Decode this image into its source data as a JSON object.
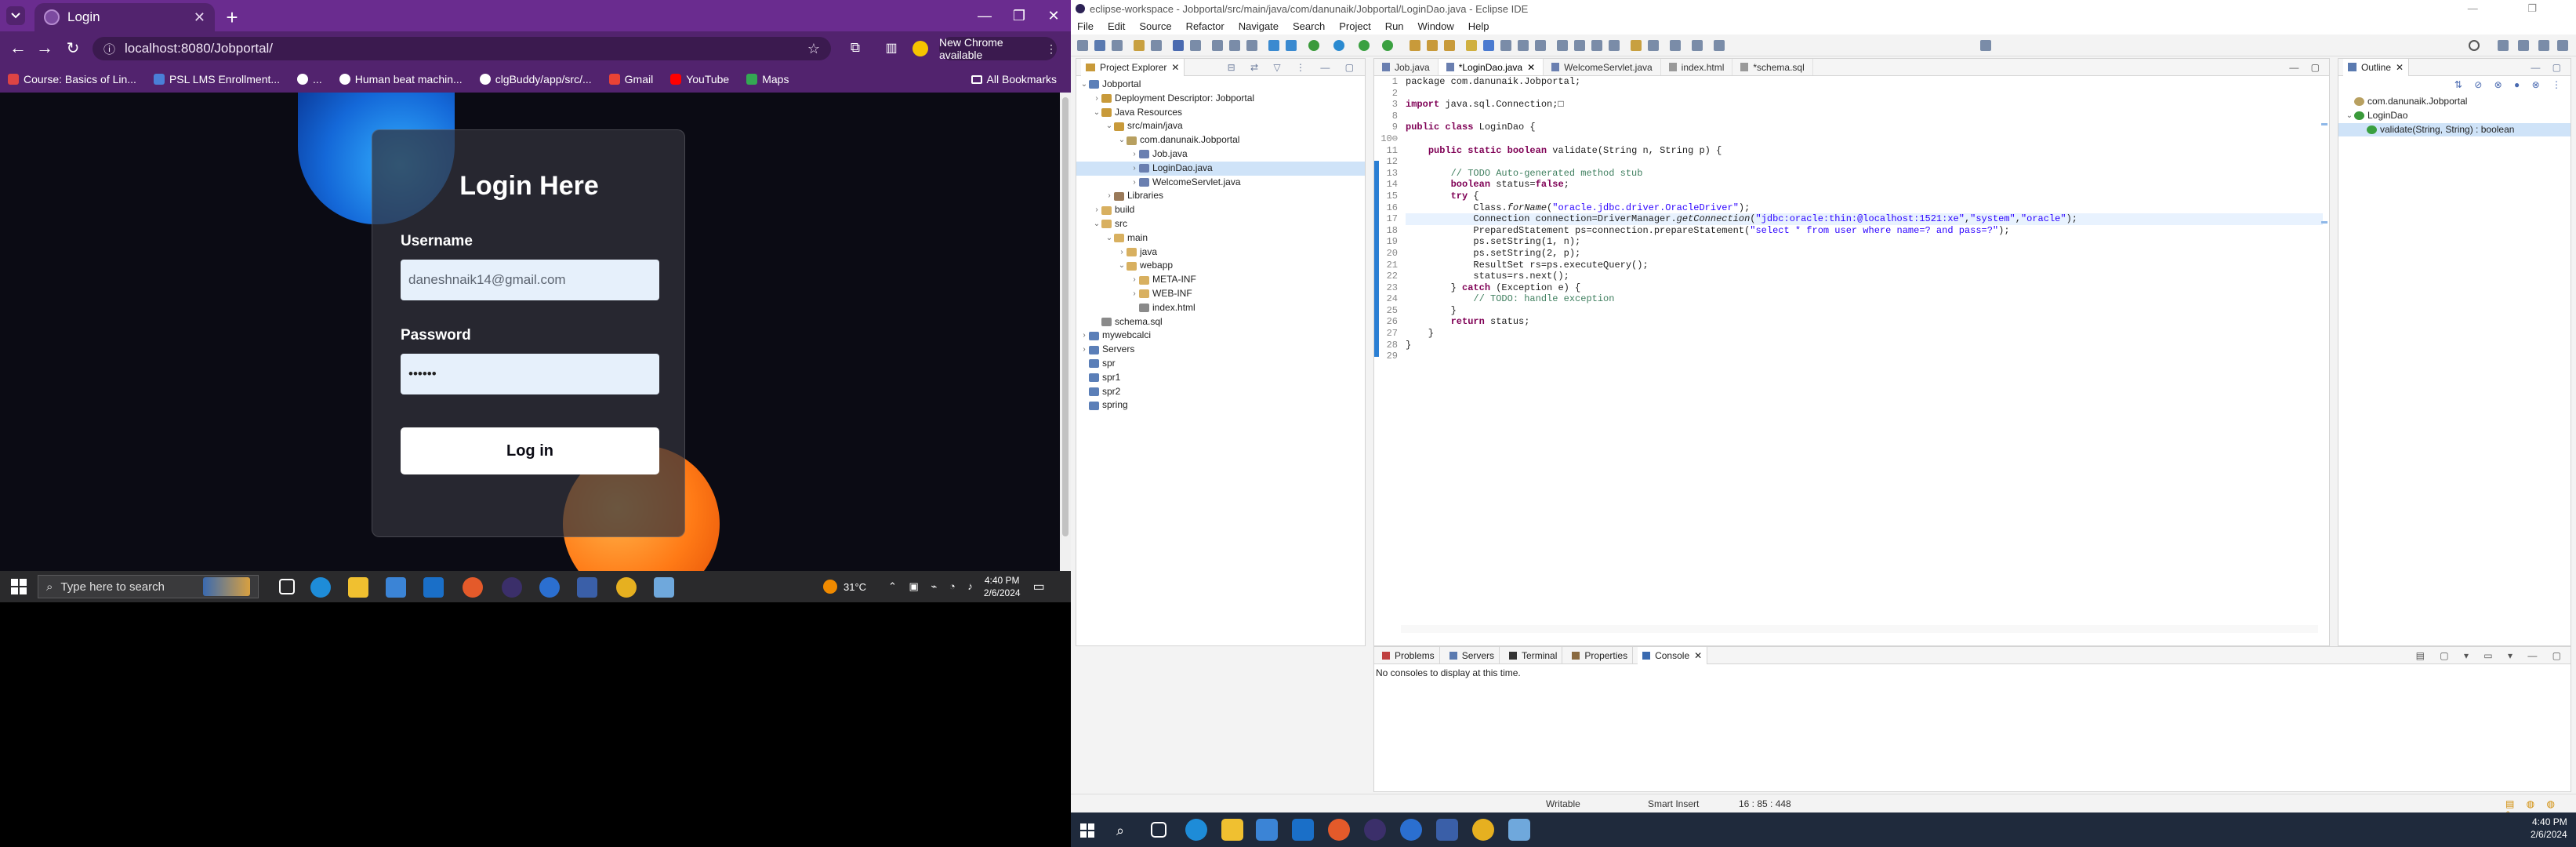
{
  "colors": {
    "chrome_frame": "#6a2c8f",
    "chrome_toolbar": "#52236e",
    "eclipse_bg": "#f3f3f3",
    "keyword": "#7f0055",
    "string": "#2a00ff",
    "comment": "#3f7f5f"
  },
  "chrome": {
    "tab_title": "Login",
    "url": "localhost:8080/Jobportal/",
    "update_label": "New Chrome available",
    "bookmarks": [
      "Course: Basics of Lin...",
      "PSL LMS Enrollment...",
      "...",
      "Human beat machin...",
      "clgBuddy/app/src/...",
      "Gmail",
      "YouTube",
      "Maps"
    ],
    "all_bookmarks": "All Bookmarks",
    "page": {
      "heading": "Login Here",
      "username_label": "Username",
      "username_value": "daneshnaik14@gmail.com",
      "password_label": "Password",
      "password_value": "••••••",
      "login_button": "Log in"
    }
  },
  "taskbar_left": {
    "search_placeholder": "Type here to search",
    "weather": "31°C",
    "time": "4:40 PM",
    "date": "2/6/2024"
  },
  "eclipse": {
    "title": "eclipse-workspace - Jobportal/src/main/java/com/danunaik/Jobportal/LoginDao.java - Eclipse IDE",
    "menu": [
      "File",
      "Edit",
      "Source",
      "Refactor",
      "Navigate",
      "Search",
      "Project",
      "Run",
      "Window",
      "Help"
    ],
    "explorer_tab": "Project Explorer",
    "tree": [
      {
        "depth": 0,
        "arrow": "⌄",
        "label": "Jobportal",
        "color": "#5b7fb8"
      },
      {
        "depth": 1,
        "arrow": "›",
        "label": "Deployment Descriptor: Jobportal",
        "color": "#c89a3a"
      },
      {
        "depth": 1,
        "arrow": "⌄",
        "label": "Java Resources",
        "color": "#c89a3a"
      },
      {
        "depth": 2,
        "arrow": "⌄",
        "label": "src/main/java",
        "color": "#c89a3a"
      },
      {
        "depth": 3,
        "arrow": "⌄",
        "label": "com.danunaik.Jobportal",
        "color": "#b8a060"
      },
      {
        "depth": 4,
        "arrow": "›",
        "label": "Job.java",
        "color": "#6a7fb0"
      },
      {
        "depth": 4,
        "arrow": "›",
        "label": "LoginDao.java",
        "color": "#6a7fb0",
        "selected": true
      },
      {
        "depth": 4,
        "arrow": "›",
        "label": "WelcomeServlet.java",
        "color": "#6a7fb0"
      },
      {
        "depth": 2,
        "arrow": "›",
        "label": "Libraries",
        "color": "#9a7a5a"
      },
      {
        "depth": 1,
        "arrow": "›",
        "label": "build",
        "color": "#d8b060"
      },
      {
        "depth": 1,
        "arrow": "⌄",
        "label": "src",
        "color": "#d8b060"
      },
      {
        "depth": 2,
        "arrow": "⌄",
        "label": "main",
        "color": "#d8b060"
      },
      {
        "depth": 3,
        "arrow": "›",
        "label": "java",
        "color": "#d8b060"
      },
      {
        "depth": 3,
        "arrow": "⌄",
        "label": "webapp",
        "color": "#d8b060"
      },
      {
        "depth": 4,
        "arrow": "›",
        "label": "META-INF",
        "color": "#d8b060"
      },
      {
        "depth": 4,
        "arrow": "›",
        "label": "WEB-INF",
        "color": "#d8b060"
      },
      {
        "depth": 4,
        "arrow": "",
        "label": "index.html",
        "color": "#8a8a8a"
      },
      {
        "depth": 1,
        "arrow": "",
        "label": "schema.sql",
        "color": "#8a8a8a"
      },
      {
        "depth": 0,
        "arrow": "›",
        "label": "mywebcalci",
        "color": "#5b7fb8"
      },
      {
        "depth": 0,
        "arrow": "›",
        "label": "Servers",
        "color": "#5b7fb8"
      },
      {
        "depth": 0,
        "arrow": "",
        "label": "spr",
        "color": "#5b7fb8"
      },
      {
        "depth": 0,
        "arrow": "",
        "label": "spr1",
        "color": "#5b7fb8"
      },
      {
        "depth": 0,
        "arrow": "",
        "label": "spr2",
        "color": "#5b7fb8"
      },
      {
        "depth": 0,
        "arrow": "",
        "label": "spring",
        "color": "#5b7fb8"
      }
    ],
    "editor_tabs": [
      "Job.java",
      "*LoginDao.java",
      "WelcomeServlet.java",
      "index.html",
      "*schema.sql"
    ],
    "active_tab": 1,
    "code_lines": [
      [
        [
          "package com.danunaik.Jobportal;",
          ""
        ]
      ],
      [
        [
          "",
          ""
        ]
      ],
      [
        [
          "import ",
          "kw"
        ],
        [
          "java.sql.Connection;□",
          ""
        ]
      ],
      [
        [
          "",
          ""
        ]
      ],
      [
        [
          "public class ",
          "kw"
        ],
        [
          "LoginDao {",
          ""
        ]
      ],
      [
        [
          "",
          ""
        ]
      ],
      [
        [
          "    ",
          ""
        ],
        [
          "public static boolean ",
          "kw"
        ],
        [
          "validate(String n, String p) {",
          ""
        ]
      ],
      [
        [
          "",
          ""
        ]
      ],
      [
        [
          "        ",
          ""
        ],
        [
          "// TODO Auto-generated method stub",
          "cmt"
        ]
      ],
      [
        [
          "        ",
          ""
        ],
        [
          "boolean ",
          "kw"
        ],
        [
          "status=",
          ""
        ],
        [
          "false",
          "kw"
        ],
        [
          ";",
          ""
        ]
      ],
      [
        [
          "        ",
          ""
        ],
        [
          "try ",
          "kw"
        ],
        [
          "{",
          ""
        ]
      ],
      [
        [
          "            Class.",
          ""
        ],
        [
          "forName",
          "it"
        ],
        [
          "(",
          ""
        ],
        [
          "\"oracle.jdbc.driver.OracleDriver\"",
          "str"
        ],
        [
          ");",
          ""
        ]
      ],
      [
        [
          "            Connection connection=DriverManager.",
          ""
        ],
        [
          "getConnection",
          "it"
        ],
        [
          "(",
          ""
        ],
        [
          "\"jdbc:oracle:thin:@localhost:1521:xe\"",
          "str"
        ],
        [
          ",",
          ""
        ],
        [
          "\"system\"",
          "str"
        ],
        [
          ",",
          ""
        ],
        [
          "\"oracle\"",
          "str"
        ],
        [
          ");",
          ""
        ]
      ],
      [
        [
          "            PreparedStatement ps=connection.prepareStatement(",
          ""
        ],
        [
          "\"select * from user where name=? and pass=?\"",
          "str"
        ],
        [
          ");",
          ""
        ]
      ],
      [
        [
          "            ps.setString(1, n);",
          ""
        ]
      ],
      [
        [
          "            ps.setString(2, p);",
          ""
        ]
      ],
      [
        [
          "            ResultSet rs=ps.executeQuery();",
          ""
        ]
      ],
      [
        [
          "            status=rs.next();",
          ""
        ]
      ],
      [
        [
          "        } ",
          ""
        ],
        [
          "catch ",
          "kw"
        ],
        [
          "(Exception e) {",
          ""
        ]
      ],
      [
        [
          "            ",
          ""
        ],
        [
          "// TODO: handle exception",
          "cmt"
        ]
      ],
      [
        [
          "        }",
          ""
        ]
      ],
      [
        [
          "        ",
          ""
        ],
        [
          "return ",
          "kw"
        ],
        [
          "status;",
          ""
        ]
      ],
      [
        [
          "    }",
          ""
        ]
      ],
      [
        [
          "}",
          ""
        ]
      ],
      [
        [
          "",
          ""
        ]
      ]
    ],
    "line_numbers": [
      "1",
      "2",
      "3",
      "8",
      "9",
      "10⊖",
      "11",
      "12",
      "13",
      "14",
      "15",
      "16",
      "17",
      "18",
      "19",
      "20",
      "21",
      "22",
      "23",
      "24",
      "25",
      "26",
      "27",
      "28",
      "29"
    ],
    "current_line_index": 12,
    "outline_tab": "Outline",
    "outline": [
      {
        "depth": 0,
        "label": "com.danunaik.Jobportal"
      },
      {
        "depth": 0,
        "label": "LoginDao"
      },
      {
        "depth": 1,
        "label": "validate(String, String) : boolean"
      }
    ],
    "bottom_tabs": [
      "Problems",
      "Servers",
      "Terminal",
      "Properties",
      "Console"
    ],
    "console_message": "No consoles to display at this time.",
    "status": {
      "writable": "Writable",
      "insert": "Smart Insert",
      "position": "16 : 85 : 448"
    },
    "time": "4:40 PM",
    "date": "2/6/2024"
  }
}
